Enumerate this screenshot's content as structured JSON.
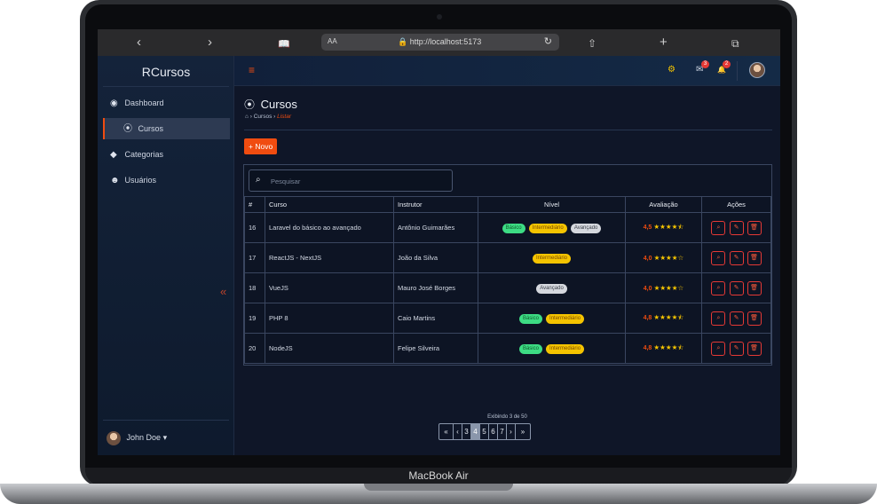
{
  "device": {
    "brand_label": "MacBook Air"
  },
  "browser": {
    "back_glyph": "‹",
    "forward_glyph": "›",
    "reader_glyph": "📖",
    "aa_label": "AA",
    "url": "🔒 http://localhost:5173",
    "reload_glyph": "↻",
    "share_glyph": "⇧",
    "new_tab_glyph": "+",
    "tabs_glyph": "⧉"
  },
  "sidebar": {
    "brand": "RCursos",
    "items": [
      {
        "icon": "dashboard-icon",
        "glyph": "◉",
        "label": "Dashboard"
      },
      {
        "icon": "play-circle-icon",
        "glyph": "⦿",
        "label": "Cursos"
      },
      {
        "icon": "tags-icon",
        "glyph": "◆",
        "label": "Categorias"
      },
      {
        "icon": "users-icon",
        "glyph": "☻",
        "label": "Usuários"
      }
    ],
    "collapse_glyph": "«",
    "user": {
      "name": "John Doe",
      "caret": "▾"
    }
  },
  "topbar": {
    "menu_glyph": "≡",
    "gear_glyph": "⚙",
    "mail_glyph": "✉",
    "mail_count": "3",
    "bell_glyph": "🔔",
    "bell_count": "2"
  },
  "page": {
    "title": "Cursos",
    "title_glyph": "⦿",
    "breadcrumb": {
      "home_glyph": "⌂",
      "sep": "›",
      "section": "Cursos",
      "current": "Listar"
    },
    "new_button": "+ Novo"
  },
  "search": {
    "placeholder": "Pesquisar",
    "glyph": "⌕"
  },
  "table": {
    "headers": [
      "#",
      "Curso",
      "Instrutor",
      "Nível",
      "Avaliação",
      "Ações"
    ],
    "rows": [
      {
        "id": "16",
        "course": "Laravel do básico ao avançado",
        "instructor": "Antônio Guimarães",
        "levels": [
          "Básico",
          "Intermediário",
          "Avançado"
        ],
        "rating": "4,5",
        "stars": "★★★★⯪"
      },
      {
        "id": "17",
        "course": "ReactJS - NextJS",
        "instructor": "João da Silva",
        "levels": [
          "Intermediário"
        ],
        "rating": "4,0",
        "stars": "★★★★☆"
      },
      {
        "id": "18",
        "course": "VueJS",
        "instructor": "Mauro José Borges",
        "levels": [
          "Avançado"
        ],
        "rating": "4,0",
        "stars": "★★★★☆"
      },
      {
        "id": "19",
        "course": "PHP 8",
        "instructor": "Caio Martins",
        "levels": [
          "Básico",
          "Intermediário"
        ],
        "rating": "4,8",
        "stars": "★★★★⯪"
      },
      {
        "id": "20",
        "course": "NodeJS",
        "instructor": "Felipe Silveira",
        "levels": [
          "Básico",
          "Intermediário"
        ],
        "rating": "4,8",
        "stars": "★★★★⯪"
      }
    ],
    "actions": {
      "view_glyph": "⌕",
      "edit_glyph": "✎",
      "delete_glyph": "🗑"
    }
  },
  "pagination": {
    "info": "Exibindo 3 de 50",
    "first": "«",
    "prev": "‹",
    "pages": [
      "3",
      "4",
      "5",
      "6",
      "7"
    ],
    "current_page": "4",
    "next": "›",
    "last": "»"
  },
  "colors": {
    "accent": "#f04c10",
    "star": "#f5c400",
    "danger": "#e53935"
  }
}
